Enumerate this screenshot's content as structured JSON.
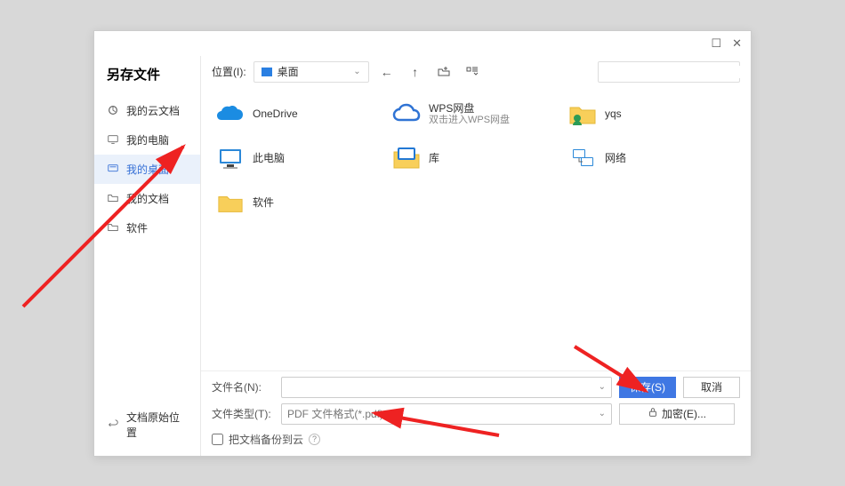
{
  "dialog_title": "另存文件",
  "sidebar": {
    "items": [
      {
        "label": "我的云文档"
      },
      {
        "label": "我的电脑"
      },
      {
        "label": "我的桌面",
        "active": true
      },
      {
        "label": "我的文档"
      },
      {
        "label": "软件"
      }
    ],
    "bottom_label": "文档原始位置"
  },
  "toolbar": {
    "location_label": "位置(I):",
    "location_value": "桌面",
    "search_placeholder": ""
  },
  "files": [
    {
      "name": "OneDrive",
      "sub": ""
    },
    {
      "name": "WPS网盘",
      "sub": "双击进入WPS网盘"
    },
    {
      "name": "yqs",
      "sub": ""
    },
    {
      "name": "此电脑",
      "sub": ""
    },
    {
      "name": "库",
      "sub": ""
    },
    {
      "name": "网络",
      "sub": ""
    },
    {
      "name": "软件",
      "sub": ""
    }
  ],
  "bottom": {
    "filename_label": "文件名(N):",
    "filename_value": "",
    "filetype_label": "文件类型(T):",
    "filetype_value": "PDF 文件格式(*.pdf)",
    "save_label": "保存(S)",
    "cancel_label": "取消",
    "encrypt_label": "加密(E)...",
    "backup_label": "把文档备份到云",
    "backup_checked": false
  }
}
